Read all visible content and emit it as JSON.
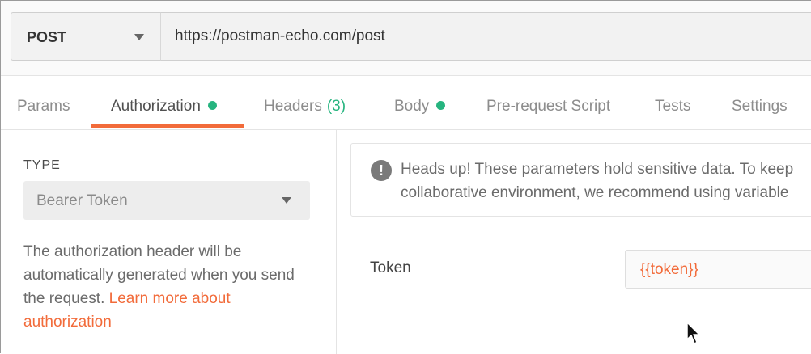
{
  "request": {
    "method": "POST",
    "url": "https://postman-echo.com/post"
  },
  "tabs": [
    {
      "label": "Params"
    },
    {
      "label": "Authorization"
    },
    {
      "label": "Headers",
      "count": "(3)"
    },
    {
      "label": "Body"
    },
    {
      "label": "Pre-request Script"
    },
    {
      "label": "Tests"
    },
    {
      "label": "Settings"
    }
  ],
  "auth": {
    "type_label": "TYPE",
    "type_value": "Bearer Token",
    "help_text": "The authorization header will be automatically generated when you send the request.",
    "help_link": "Learn more about authorization"
  },
  "notice": {
    "line1": "Heads up! These parameters hold sensitive data. To keep",
    "line2": "collaborative environment, we recommend using variable"
  },
  "token": {
    "label": "Token",
    "value": "{{token}}"
  },
  "colors": {
    "accent": "#f26b3a",
    "indicator_dot": "#26b47f"
  }
}
